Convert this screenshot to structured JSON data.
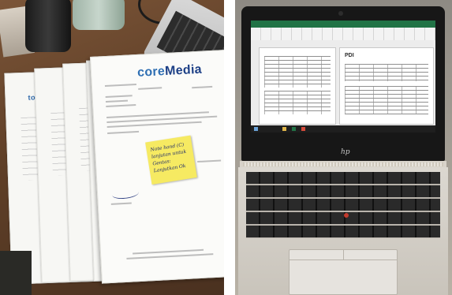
{
  "left_photo": {
    "letterhead_brand_part1": "core",
    "letterhead_brand_part2": "Media",
    "back_sheet_label": "toko",
    "sticky_note_text": "Note hand (C) lanjutan untuk Gentas: Lanjutkan Ok"
  },
  "right_photo": {
    "screen_logo": "PDI",
    "laptop_logo": "hp",
    "spreadsheet_app_color": "#217346"
  }
}
